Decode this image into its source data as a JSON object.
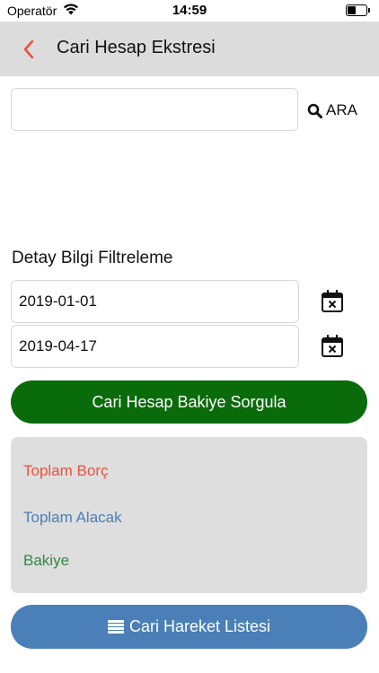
{
  "status_bar": {
    "carrier": "Operatör",
    "time": "14:59",
    "battery_level": 0.4
  },
  "navbar": {
    "back_icon": "chevron-left-icon",
    "title": "Cari Hesap Ekstresi",
    "accent_color": "#e8523c"
  },
  "search": {
    "value": "",
    "button_label": "ARA",
    "icon": "search-icon"
  },
  "filter": {
    "section_title": "Detay Bilgi Filtreleme",
    "start_date": "2019-01-01",
    "end_date": "2019-04-17",
    "calendar_icon": "calendar-clear-icon"
  },
  "actions": {
    "query_label": "Cari Hesap Bakiye Sorgula",
    "query_color": "#0a6b0a",
    "list_label": "Cari Hareket Listesi",
    "list_icon": "list-icon",
    "list_color": "#4a7fb8"
  },
  "summary": {
    "debt_label": "Toplam Borç",
    "debt_color": "#e8523c",
    "credit_label": "Toplam Alacak",
    "credit_color": "#4a7fb8",
    "balance_label": "Bakiye",
    "balance_color": "#2e8b3e"
  }
}
